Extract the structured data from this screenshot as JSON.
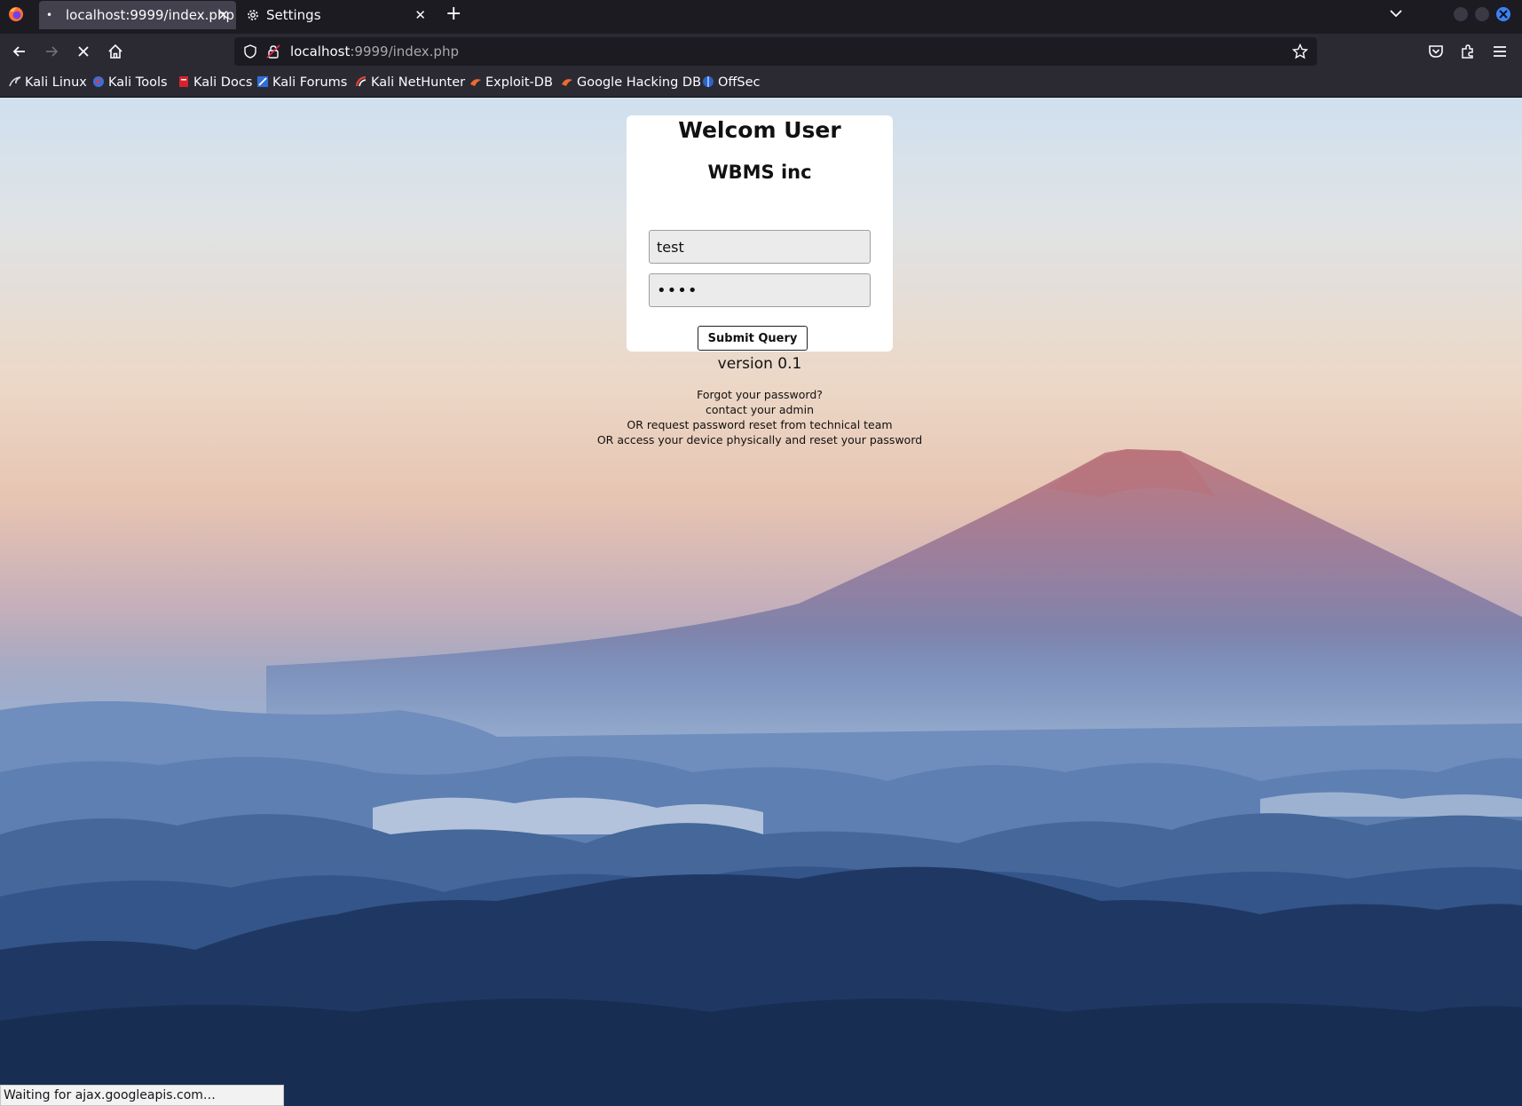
{
  "browser": {
    "tabs": [
      {
        "label": "localhost:9999/index.php",
        "active": true
      },
      {
        "label": "Settings",
        "active": false
      }
    ],
    "url": {
      "host": "localhost",
      "path": ":9999/index.php"
    },
    "bookmarks": [
      {
        "label": "Kali Linux",
        "icon": "kali-dragon-icon"
      },
      {
        "label": "Kali Tools",
        "icon": "kali-tools-icon"
      },
      {
        "label": "Kali Docs",
        "icon": "kali-docs-icon"
      },
      {
        "label": "Kali Forums",
        "icon": "kali-forums-icon"
      },
      {
        "label": "Kali NetHunter",
        "icon": "nethunter-icon"
      },
      {
        "label": "Exploit-DB",
        "icon": "exploit-db-icon"
      },
      {
        "label": "Google Hacking DB",
        "icon": "ghdb-icon"
      },
      {
        "label": "OffSec",
        "icon": "offsec-icon"
      }
    ],
    "status": "Waiting for ajax.googleapis.com…"
  },
  "login": {
    "title": "Welcom User",
    "subtitle": "WBMS inc",
    "username_value": "test",
    "password_value": "test",
    "submit_label": "Submit Query"
  },
  "footer": {
    "version": "version 0.1",
    "help_lines": [
      "Forgot your password?",
      "contact your admin",
      "OR request password reset from technical team",
      "OR access your device physically and reset your password"
    ]
  },
  "colors": {
    "chrome_dark": "#1c1b22",
    "chrome_mid": "#2b2a33",
    "active_tab": "#42414d",
    "close_button": "#3b82f6"
  }
}
